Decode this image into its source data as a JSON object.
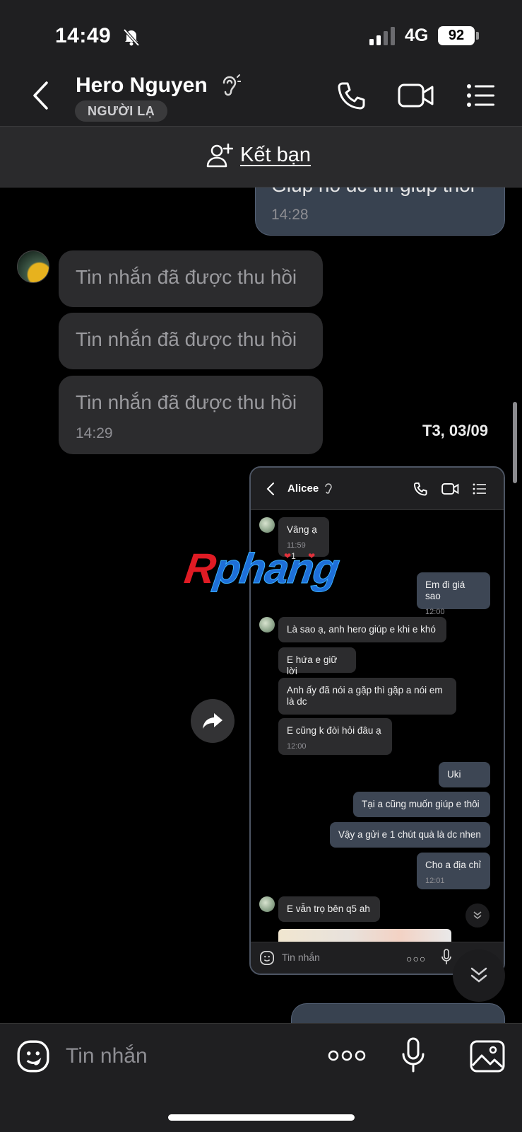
{
  "status_bar": {
    "time": "14:49",
    "network": "4G",
    "battery": "92"
  },
  "header": {
    "contact_name": "Hero Nguyen",
    "badge": "NGƯỜI LẠ"
  },
  "add_friend": {
    "label": "Kết bạn"
  },
  "messages": {
    "top_partial_text": "Giúp nổ dc thì giúp thôi",
    "top_partial_time": "14:28",
    "recalled": [
      "Tin nhắn đã được thu hồi",
      "Tin nhắn đã được thu hồi",
      "Tin nhắn đã được thu hồi"
    ],
    "recalled_time": "14:29",
    "date_label": "T3, 03/09"
  },
  "embedded_screenshot": {
    "contact_name": "Alicee",
    "input_placeholder": "Tin nhắn",
    "messages": [
      {
        "side": "them",
        "text": "Vâng ạ",
        "time": "11:59",
        "reaction_count": "1"
      },
      {
        "side": "me",
        "text": "Em đi giá sao",
        "time": "12:00"
      },
      {
        "side": "them",
        "text": "Là sao ạ, anh hero giúp e khi e khó"
      },
      {
        "side": "them",
        "text": "E hứa e giữ lời"
      },
      {
        "side": "them",
        "text": "Anh ấy đã nói a gặp thì gặp a nói em là dc"
      },
      {
        "side": "them",
        "text": "E cũng k đòi hỏi đâu ạ",
        "time": "12:00"
      },
      {
        "side": "me",
        "text": "Uki"
      },
      {
        "side": "me",
        "text": "Tại a cũng muốn giúp e thôi"
      },
      {
        "side": "me",
        "text": "Vậy a gửi e 1 chút quà là dc nhen"
      },
      {
        "side": "me",
        "text": "Cho a địa chỉ",
        "time": "12:01"
      },
      {
        "side": "them",
        "text": "E vẫn trọ bên q5 ah"
      }
    ]
  },
  "watermark": {
    "text_r": "R",
    "text_rest": "phang"
  },
  "composer": {
    "placeholder": "Tin nhắn"
  },
  "colors": {
    "bubble_me": "#384250",
    "bubble_them": "#2c2c2e",
    "bar_bg": "#1f1f21"
  }
}
